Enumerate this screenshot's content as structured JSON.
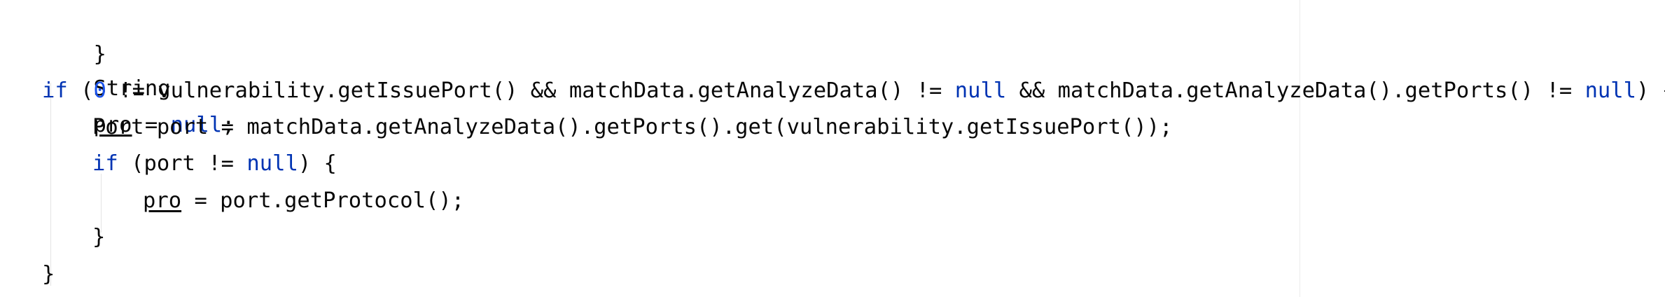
{
  "code": {
    "line1": {
      "text": "}"
    },
    "line2": {
      "type": "String",
      "var": "pro",
      "assign": " = ",
      "null": "null",
      "end": ";"
    },
    "line3": {
      "kw_if": "if",
      "open": " (",
      "zero": "0",
      "middle": " != vulnerability.getIssuePort() && matchData.getAnalyzeData() != ",
      "null1": "null",
      "middle2": " && matchData.getAnalyzeData().getPorts() != ",
      "null2": "null",
      "close": ") {"
    },
    "line4": {
      "text": "Port port = matchData.getAnalyzeData().getPorts().get(vulnerability.getIssuePort());"
    },
    "line5": {
      "kw_if": "if",
      "middle": " (port != ",
      "null": "null",
      "close": ") {"
    },
    "line6": {
      "var": "pro",
      "rest": " = port.getProtocol();"
    },
    "line7": {
      "text": "}"
    },
    "line8": {
      "text": "}"
    }
  },
  "colors": {
    "keyword": "#0033b3",
    "number": "#1750eb",
    "identifier": "#080808",
    "background": "#ffffff"
  }
}
